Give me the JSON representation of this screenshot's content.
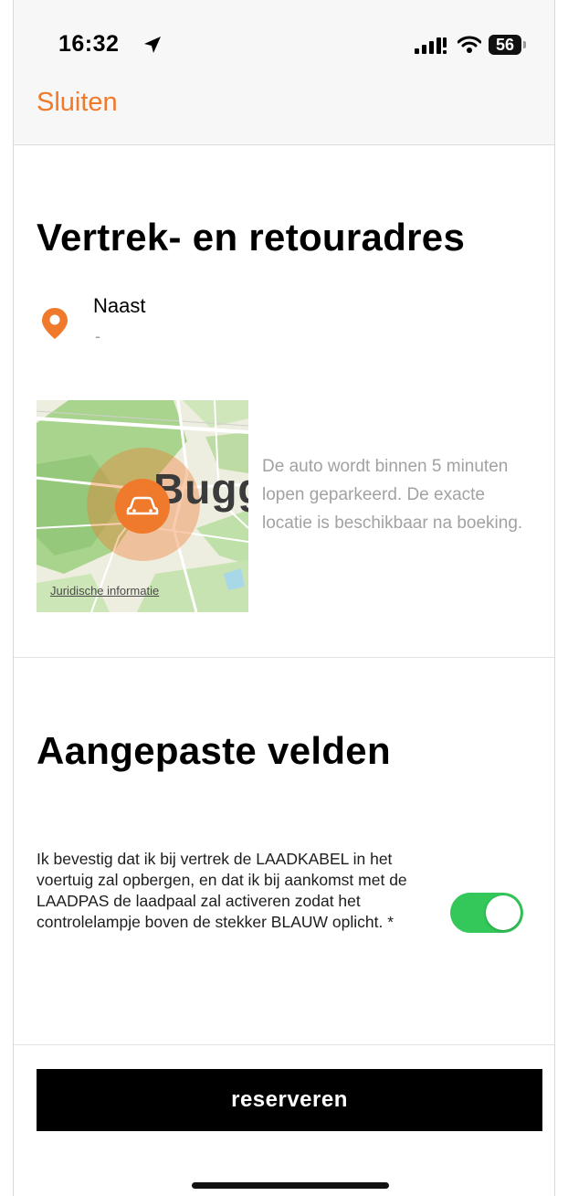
{
  "status_bar": {
    "time": "16:32",
    "battery": "56"
  },
  "nav": {
    "close_label": "Sluiten"
  },
  "pickup": {
    "title": "Vertrek- en retouradres",
    "address_name": "Naast",
    "address_detail": "-",
    "map_city_label": "Bugg",
    "map_legal_link": "Juridische informatie",
    "caption": "De auto wordt binnen 5 minuten lopen geparkeerd. De exacte locatie is beschikbaar na boeking."
  },
  "custom_fields": {
    "title": "Aangepaste velden",
    "consent_text": "Ik bevestig dat ik bij vertrek de LAADKABEL in het voertuig zal opbergen, en dat ik bij aankomst met de LAADPAS de laadpaal zal activeren zodat het controlelampje boven de stekker BLAUW oplicht. *",
    "consent_toggle_on": true
  },
  "actions": {
    "reserve_label": "reserveren"
  },
  "colors": {
    "accent": "#f07a2c",
    "toggle_on": "#34c759",
    "button_bg": "#000000"
  }
}
